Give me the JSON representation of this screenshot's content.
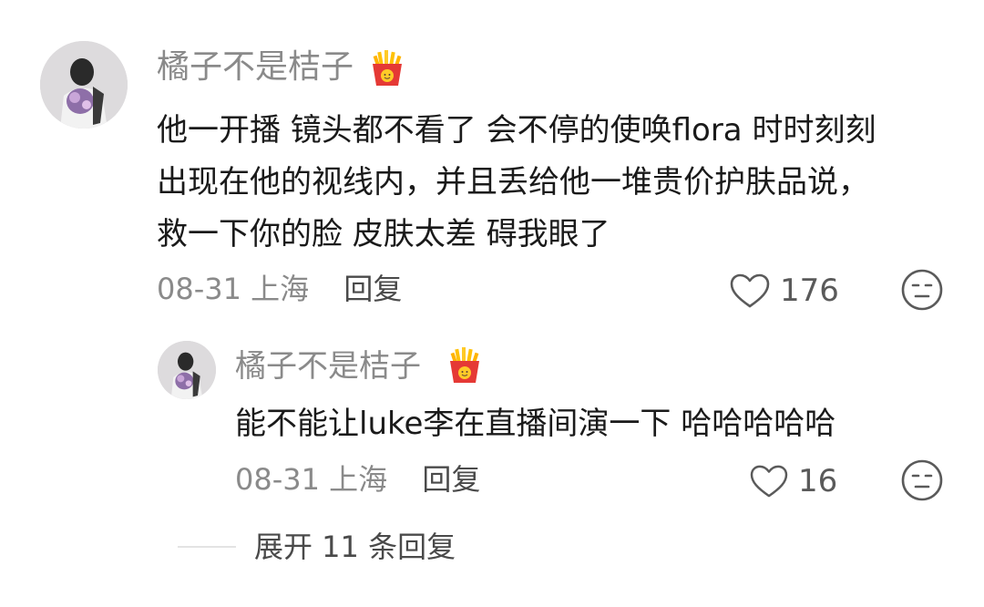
{
  "comment": {
    "username": "橘子不是桔子",
    "badge_icon": "french-fries-icon",
    "text_lines": [
      "他一开播 镜头都不看了 会不停的使唤flora 时时刻刻",
      "出现在他的视线内，并且丢给他一堆贵价护肤品说，",
      "救一下你的脸 皮肤太差 碍我眼了"
    ],
    "date": "08-31",
    "location": "上海",
    "reply_label": "回复",
    "like_count": "176"
  },
  "reply": {
    "username": "橘子不是桔子",
    "badge_icon": "french-fries-icon",
    "text": "能不能让luke李在直播间演一下 哈哈哈哈哈",
    "date": "08-31",
    "location": "上海",
    "reply_label": "回复",
    "like_count": "16"
  },
  "expand_replies": {
    "label": "展开 11 条回复"
  },
  "colors": {
    "username": "#8a8a8a",
    "text": "#1a1a1a",
    "meta": "#8a8a8a",
    "fries_box": "#e53935",
    "fries": "#ffc107"
  }
}
